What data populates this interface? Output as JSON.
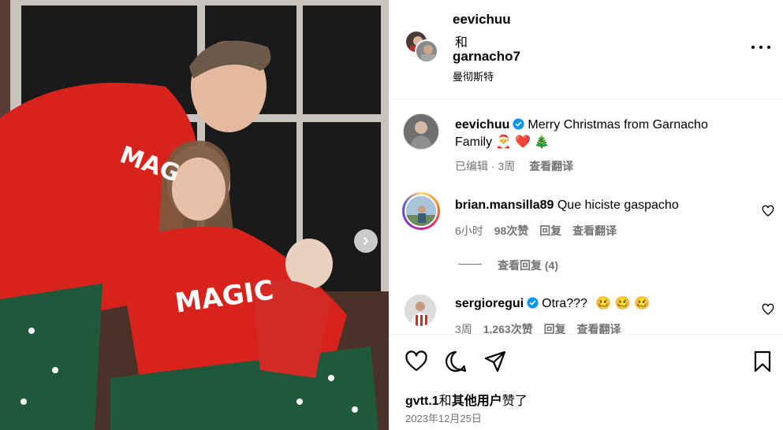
{
  "post": {
    "photo_alt": "",
    "carousel_next_icon": "chevron-right-icon"
  },
  "header": {
    "author1": "eevichuu",
    "conjunction": "和",
    "author2": "garnacho7",
    "location": "曼彻斯特",
    "more_icon": "more-horizontal-icon"
  },
  "caption": {
    "username": "eevichuu",
    "text_line1": "Merry Christmas from Garnacho",
    "text_line2": "Family",
    "emojis": [
      "🎅",
      "❤️",
      "🎄"
    ],
    "edited": "已编辑",
    "dot": " · ",
    "time": "3周",
    "translate": "查看翻译"
  },
  "comments": [
    {
      "username": "brian.mansilla89",
      "text": "Que hiciste gaspacho",
      "time": "6小时",
      "likes": "98次赞",
      "reply": "回复",
      "translate": "查看翻译",
      "view_replies": "查看回复 (4)"
    },
    {
      "username": "sergioregui",
      "verified": true,
      "text": "Otra???",
      "emojis": "🥴 🥴 🥴",
      "time": "3周",
      "likes": "1,263次赞",
      "reply": "回复",
      "translate": "查看翻译"
    }
  ],
  "actions": {
    "like_icon": "heart-icon",
    "comment_icon": "comment-icon",
    "share_icon": "send-icon",
    "save_icon": "bookmark-icon"
  },
  "likes": {
    "user": "gvtt.1",
    "and": "和",
    "others": "其他用户",
    "suffix": "赞了"
  },
  "date": "2023年12月25日",
  "colors": {
    "verified_blue": "#0095f6",
    "muted_text": "#737373",
    "border": "#efefef",
    "pajama_red": "#d8231d",
    "pajama_green": "#1e5a3a"
  }
}
